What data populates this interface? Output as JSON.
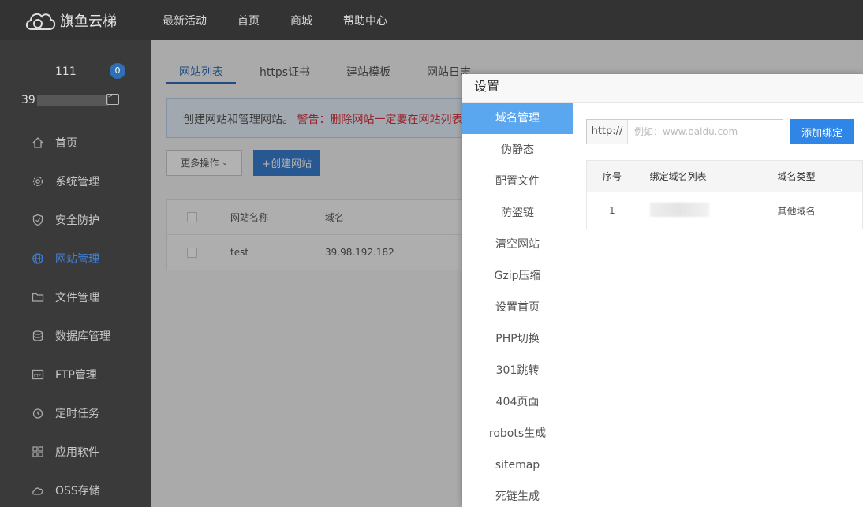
{
  "brand": {
    "name": "旗鱼云梯"
  },
  "topnav": [
    "最新活动",
    "首页",
    "商城",
    "帮助中心"
  ],
  "user": {
    "name": "111",
    "badge": "0",
    "ip_prefix": "39"
  },
  "sidebar": {
    "items": [
      {
        "label": "首页",
        "icon": "home-icon"
      },
      {
        "label": "系统管理",
        "icon": "gear-icon"
      },
      {
        "label": "安全防护",
        "icon": "shield-icon"
      },
      {
        "label": "网站管理",
        "icon": "globe-icon",
        "active": true
      },
      {
        "label": "文件管理",
        "icon": "folder-icon"
      },
      {
        "label": "数据库管理",
        "icon": "database-icon"
      },
      {
        "label": "FTP管理",
        "icon": "ftp-icon"
      },
      {
        "label": "定时任务",
        "icon": "clock-icon"
      },
      {
        "label": "应用软件",
        "icon": "apps-icon"
      },
      {
        "label": "OSS存储",
        "icon": "cloud-icon"
      }
    ]
  },
  "main": {
    "tabs": [
      "网站列表",
      "https证书",
      "建站模板",
      "网站日志"
    ],
    "notice": {
      "text": "创建网站和管理网站。",
      "warning": "警告：删除网站一定要在网站列表"
    },
    "more_button": "更多操作",
    "create_button": "+创建网站",
    "table": {
      "headers": [
        "网站名称",
        "域名"
      ],
      "rows": [
        {
          "name": "test",
          "domain": "39.98.192.182"
        }
      ]
    }
  },
  "dialog": {
    "title": "设置",
    "nav": [
      "域名管理",
      "伪静态",
      "配置文件",
      "防盗链",
      "清空网站",
      "Gzip压缩",
      "设置首页",
      "PHP切换",
      "301跳转",
      "404页面",
      "robots生成",
      "sitemap",
      "死链生成"
    ],
    "url_prefix": "http://",
    "url_placeholder": "例如：www.baidu.com",
    "bind_button": "添加绑定",
    "table": {
      "headers": [
        "序号",
        "绑定域名列表",
        "域名类型"
      ],
      "rows": [
        {
          "index": "1",
          "type": "其他域名"
        }
      ]
    }
  },
  "colors": {
    "accent": "#2f86e6",
    "active_nav": "#5aa7f0",
    "warning": "#d9363e"
  }
}
